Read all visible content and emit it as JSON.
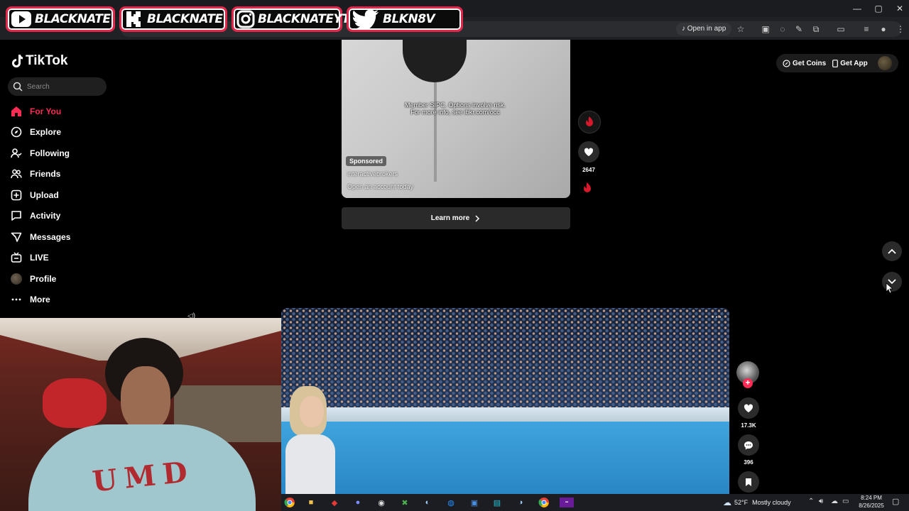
{
  "browser": {
    "open_in_app_label": "Open in app",
    "window_controls": [
      "—",
      "▢",
      "✕"
    ]
  },
  "overlay": {
    "badges": [
      {
        "platform": "youtube",
        "label": "BLACKNATE"
      },
      {
        "platform": "kick",
        "label": "BLACKNATE"
      },
      {
        "platform": "instagram",
        "label": "BLACKNATEYT"
      },
      {
        "platform": "twitter",
        "label": "BLKN8V"
      }
    ]
  },
  "tiktok": {
    "logo_text": "TikTok",
    "search_placeholder": "Search",
    "nav": [
      {
        "label": "For You",
        "icon": "home-icon",
        "active": true
      },
      {
        "label": "Explore",
        "icon": "compass-icon"
      },
      {
        "label": "Following",
        "icon": "following-icon"
      },
      {
        "label": "Friends",
        "icon": "friends-icon"
      },
      {
        "label": "Upload",
        "icon": "upload-icon"
      },
      {
        "label": "Activity",
        "icon": "activity-icon"
      },
      {
        "label": "Messages",
        "icon": "messages-icon"
      },
      {
        "label": "LIVE",
        "icon": "live-icon"
      },
      {
        "label": "Profile",
        "icon": "profile-avatar"
      },
      {
        "label": "More",
        "icon": "more-icon"
      }
    ],
    "top_buttons": {
      "get_coins": "Get Coins",
      "get_app": "Get App"
    },
    "ad": {
      "disclaimer_line1": "Member SIPC. Options involve risk.",
      "disclaimer_line2": "For more info, see ibkr.com/occ",
      "sponsored": "Sponsored",
      "handle": "interactivebrokers",
      "cta_text": "Open an account today",
      "learn_more": "Learn more",
      "likes": "2647"
    },
    "video2": {
      "likes": "17.3K",
      "comments": "396"
    }
  },
  "taskbar": {
    "weather_temp": "52°F",
    "weather_text": "Mostly cloudy",
    "time": "8:24 PM",
    "date": "8/26/2025"
  },
  "colors": {
    "accent": "#fe2c55",
    "badge_border": "#e3274b",
    "background": "#000000"
  }
}
